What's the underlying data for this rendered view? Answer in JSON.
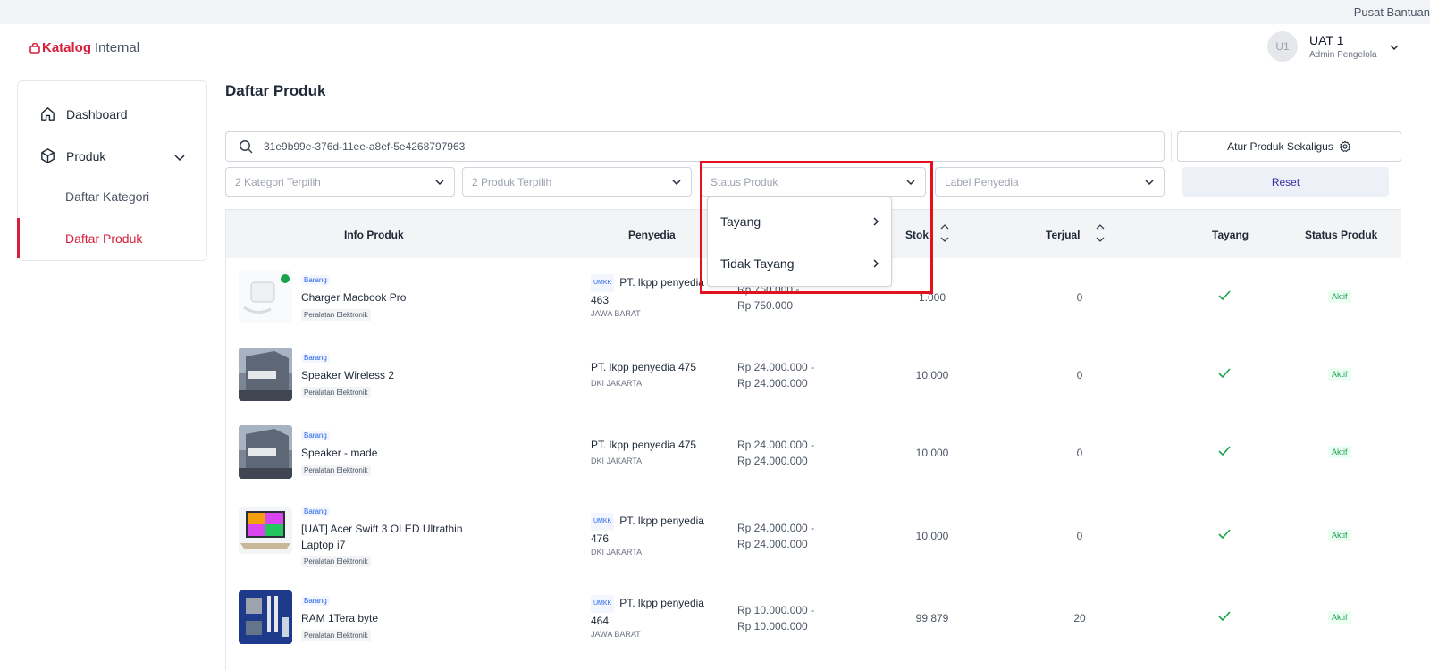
{
  "topbar": {
    "help_label": "Pusat Bantuan"
  },
  "header": {
    "brand": "Katalog",
    "brand_suffix": "Internal",
    "user": {
      "initials": "U1",
      "name": "UAT 1",
      "role": "Admin Pengelola"
    }
  },
  "sidebar": {
    "dashboard": "Dashboard",
    "produk": "Produk",
    "sub_items": [
      "Daftar Kategori",
      "Daftar Produk"
    ]
  },
  "page": {
    "title": "Daftar Produk"
  },
  "search": {
    "value": "31e9b99e-376d-11ee-a8ef-5e4268797963"
  },
  "toolbar": {
    "bulk_label": "Atur Produk Sekaligus",
    "reset_label": "Reset"
  },
  "filters": {
    "kategori": "2 Kategori Terpilih",
    "produk": "2 Produk Terpilih",
    "status": "Status Produk",
    "label": "Label Penyedia"
  },
  "dropdown": {
    "items": [
      "Tayang",
      "Tidak Tayang"
    ]
  },
  "table": {
    "headers": {
      "info": "Info Produk",
      "penyedia": "Penyedia",
      "stok": "Stok",
      "terjual": "Terjual",
      "tayang": "Tayang",
      "status": "Status Produk"
    },
    "rows": [
      {
        "type": "Barang",
        "name": "Charger Macbook Pro",
        "category": "Peralatan Elektronik",
        "umkk": "UMKK",
        "vendor": "PT. lkpp penyedia 463",
        "region": "JAWA BARAT",
        "price_line1": "Rp 750.000 -",
        "price_line2": "Rp 750.000",
        "stok": "1.000",
        "terjual": "0",
        "status": "Aktif"
      },
      {
        "type": "Barang",
        "name": "Speaker Wireless 2",
        "category": "Peralatan Elektronik",
        "umkk": "",
        "vendor": "PT. lkpp penyedia 475",
        "region": "DKI JAKARTA",
        "price_line1": "Rp 24.000.000 -",
        "price_line2": "Rp 24.000.000",
        "stok": "10.000",
        "terjual": "0",
        "status": "Aktif"
      },
      {
        "type": "Barang",
        "name": "Speaker - made",
        "category": "Peralatan Elektronik",
        "umkk": "",
        "vendor": "PT. lkpp penyedia 475",
        "region": "DKI JAKARTA",
        "price_line1": "Rp 24.000.000 -",
        "price_line2": "Rp 24.000.000",
        "stok": "10.000",
        "terjual": "0",
        "status": "Aktif"
      },
      {
        "type": "Barang",
        "name": "[UAT] Acer Swift 3 OLED Ultrathin Laptop i7",
        "category": "Peralatan Elektronik",
        "umkk": "UMKK",
        "vendor": "PT. lkpp penyedia 476",
        "region": "DKI JAKARTA",
        "price_line1": "Rp 24.000.000 -",
        "price_line2": "Rp 24.000.000",
        "stok": "10.000",
        "terjual": "0",
        "status": "Aktif"
      },
      {
        "type": "Barang",
        "name": "RAM 1Tera byte",
        "category": "Peralatan Elektronik",
        "umkk": "UMKK",
        "vendor": "PT. lkpp penyedia 464",
        "region": "JAWA BARAT",
        "price_line1": "Rp 10.000.000 -",
        "price_line2": "Rp 10.000.000",
        "stok": "99.879",
        "terjual": "20",
        "status": "Aktif"
      }
    ]
  },
  "colors": {
    "brand": "#d61f3c",
    "highlight": "#e3111b",
    "active": "#16a34a",
    "link": "#2563eb"
  }
}
